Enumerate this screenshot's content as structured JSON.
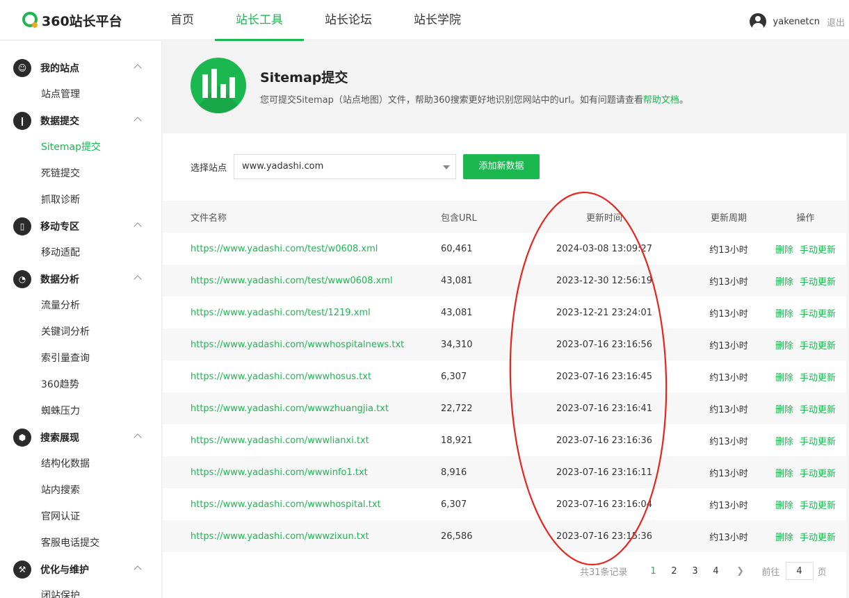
{
  "header": {
    "logo_text": "360站长平台",
    "nav": [
      "首页",
      "站长工具",
      "站长论坛",
      "站长学院"
    ],
    "active_nav": 1,
    "username": "yakenetcn",
    "logout": "退出"
  },
  "sidebar": {
    "groups": [
      {
        "title": "我的站点",
        "icon": "user-icon",
        "items": [
          "站点管理"
        ]
      },
      {
        "title": "数据提交",
        "icon": "bar-chart-icon",
        "items": [
          "Sitemap提交",
          "死链提交",
          "抓取诊断"
        ]
      },
      {
        "title": "移动专区",
        "icon": "mobile-icon",
        "items": [
          "移动适配"
        ]
      },
      {
        "title": "数据分析",
        "icon": "pie-chart-icon",
        "items": [
          "流量分析",
          "关键词分析",
          "索引量查询",
          "360趋势",
          "蜘蛛压力"
        ]
      },
      {
        "title": "搜索展现",
        "icon": "cube-icon",
        "items": [
          "结构化数据",
          "站内搜索",
          "官网认证",
          "客服电话提交"
        ]
      },
      {
        "title": "优化与维护",
        "icon": "tools-icon",
        "items": [
          "闭站保护"
        ]
      }
    ],
    "active_item": "Sitemap提交"
  },
  "banner": {
    "title": "Sitemap提交",
    "desc_prefix": "您可提交Sitemap（站点地图）文件，帮助360搜索更好地识别您网站中的url。如有问题请查看",
    "help_link": "帮助文档",
    "desc_suffix": "。"
  },
  "filter": {
    "label": "选择站点",
    "selected_site": "www.yadashi.com",
    "add_button": "添加新数据"
  },
  "table": {
    "headers": [
      "文件名称",
      "包含URL",
      "更新时间",
      "更新周期",
      "操作"
    ],
    "rows": [
      {
        "file": "https://www.yadashi.com/test/w0608.xml",
        "urls": "60,461",
        "time": "2024-03-08 13:09:27",
        "cycle": "约13小时"
      },
      {
        "file": "https://www.yadashi.com/test/www0608.xml",
        "urls": "43,081",
        "time": "2023-12-30 12:56:19",
        "cycle": "约13小时"
      },
      {
        "file": "https://www.yadashi.com/test/1219.xml",
        "urls": "43,081",
        "time": "2023-12-21 23:24:01",
        "cycle": "约13小时"
      },
      {
        "file": "https://www.yadashi.com/wwwhospitalnews.txt",
        "urls": "34,310",
        "time": "2023-07-16 23:16:56",
        "cycle": "约13小时"
      },
      {
        "file": "https://www.yadashi.com/wwwhosus.txt",
        "urls": "6,307",
        "time": "2023-07-16 23:16:45",
        "cycle": "约13小时"
      },
      {
        "file": "https://www.yadashi.com/wwwzhuangjia.txt",
        "urls": "22,722",
        "time": "2023-07-16 23:16:41",
        "cycle": "约13小时"
      },
      {
        "file": "https://www.yadashi.com/wwwlianxi.txt",
        "urls": "18,921",
        "time": "2023-07-16 23:16:36",
        "cycle": "约13小时"
      },
      {
        "file": "https://www.yadashi.com/wwwinfo1.txt",
        "urls": "8,916",
        "time": "2023-07-16 23:16:11",
        "cycle": "约13小时"
      },
      {
        "file": "https://www.yadashi.com/wwwhospital.txt",
        "urls": "6,307",
        "time": "2023-07-16 23:16:04",
        "cycle": "约13小时"
      },
      {
        "file": "https://www.yadashi.com/wwwzixun.txt",
        "urls": "26,586",
        "time": "2023-07-16 23:15:36",
        "cycle": "约13小时"
      }
    ],
    "op_delete": "删除",
    "op_update": "手动更新"
  },
  "pager": {
    "total": "共31条记录",
    "pages": [
      "1",
      "2",
      "3",
      "4"
    ],
    "active_page": "1",
    "goto_prefix": "前往",
    "goto_value": "4",
    "goto_suffix": "页"
  },
  "colors": {
    "accent": "#1bb850",
    "annotation": "#e8231b"
  }
}
